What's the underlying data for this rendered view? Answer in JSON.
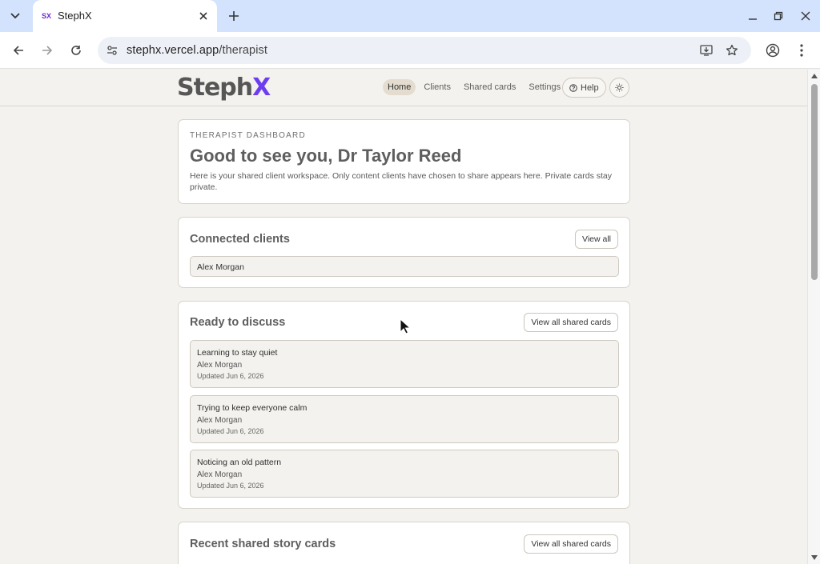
{
  "browser": {
    "tab_title": "StephX",
    "favicon_text": "SX",
    "url_host": "stephx.vercel.app",
    "url_path": "/therapist",
    "icons": [
      "tab-list-icon",
      "close-icon",
      "plus-icon",
      "minimize-icon",
      "restore-icon",
      "window-close-icon",
      "back-icon",
      "forward-icon",
      "reload-icon",
      "site-info-icon",
      "install-app-icon",
      "star-icon",
      "profile-icon",
      "more-icon"
    ]
  },
  "header": {
    "logo_main": "Steph",
    "logo_accent": "X",
    "logo_accent_color": "#6d3df2",
    "nav": [
      "Home",
      "Clients",
      "Shared cards",
      "Settings"
    ],
    "active_nav": "Home",
    "help_label": "Help",
    "theme_icon": "sun-icon"
  },
  "welcome": {
    "eyebrow": "THERAPIST DASHBOARD",
    "title": "Good to see you, Dr Taylor Reed",
    "description": "Here is your shared client workspace. Only content clients have chosen to share appears here. Private cards stay private."
  },
  "connected": {
    "title": "Connected clients",
    "button": "View all",
    "clients": [
      "Alex Morgan"
    ]
  },
  "discuss": {
    "title": "Ready to discuss",
    "button": "View all shared cards",
    "items": [
      {
        "title": "Learning to stay quiet",
        "client": "Alex Morgan",
        "date": "Updated Jun 6, 2026"
      },
      {
        "title": "Trying to keep everyone calm",
        "client": "Alex Morgan",
        "date": "Updated Jun 6, 2026"
      },
      {
        "title": "Noticing an old pattern",
        "client": "Alex Morgan",
        "date": "Updated Jun 6, 2026"
      }
    ]
  },
  "recent": {
    "title": "Recent shared story cards",
    "button": "View all shared cards"
  }
}
